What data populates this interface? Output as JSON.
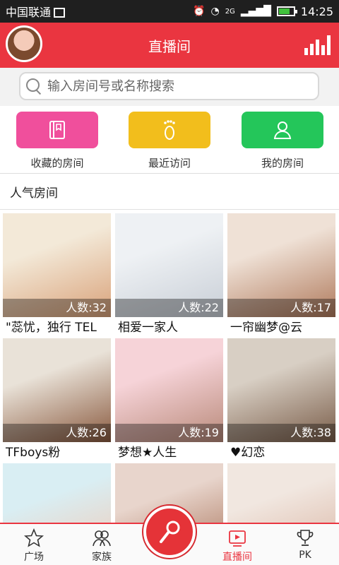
{
  "status_bar": {
    "carrier": "中国联通",
    "time": "14:25",
    "network": "2G"
  },
  "header": {
    "title": "直播间"
  },
  "search": {
    "placeholder": "输入房间号或名称搜索"
  },
  "shortcuts": [
    {
      "label": "收藏的房间",
      "color": "#f04f9c",
      "icon": "bookmark-book-icon"
    },
    {
      "label": "最近访问",
      "color": "#f2be1c",
      "icon": "footprint-icon"
    },
    {
      "label": "我的房间",
      "color": "#24c65a",
      "icon": "person-icon"
    }
  ],
  "section": {
    "title": "人气房间"
  },
  "rooms": [
    {
      "count": "人数:32",
      "name": "\"蕊忧，独行 TEL",
      "bg": [
        "#f3e9d8",
        "#d9a27a"
      ]
    },
    {
      "count": "人数:22",
      "name": "相爱一家人",
      "bg": [
        "#eef1f4",
        "#c8ced6"
      ]
    },
    {
      "count": "人数:17",
      "name": "一帘幽梦@云",
      "bg": [
        "#efe1d6",
        "#b07a5c"
      ]
    },
    {
      "count": "人数:26",
      "name": "TFboys粉",
      "bg": [
        "#e9e2d8",
        "#8a5a3f"
      ]
    },
    {
      "count": "人数:19",
      "name": "梦想★人生",
      "bg": [
        "#f6d3d8",
        "#b98a7a"
      ]
    },
    {
      "count": "人数:38",
      "name": "♥幻恋",
      "bg": [
        "#d8cfc4",
        "#7a5d49"
      ]
    },
    {
      "count": "",
      "name": "",
      "bg": [
        "#d9eef3",
        "#f0c9b5"
      ]
    },
    {
      "count": "",
      "name": "",
      "bg": [
        "#e8d5cc",
        "#a66f55"
      ]
    },
    {
      "count": "",
      "name": "",
      "bg": [
        "#f1e7e0",
        "#d9b3a1"
      ]
    }
  ],
  "tabs": [
    {
      "label": "广场",
      "icon": "star-icon"
    },
    {
      "label": "家族",
      "icon": "family-icon"
    },
    {
      "label": "直播间",
      "icon": "live-room-icon",
      "active": true
    },
    {
      "label": "PK",
      "icon": "trophy-icon"
    }
  ],
  "colors": {
    "brand": "#ea3540"
  }
}
